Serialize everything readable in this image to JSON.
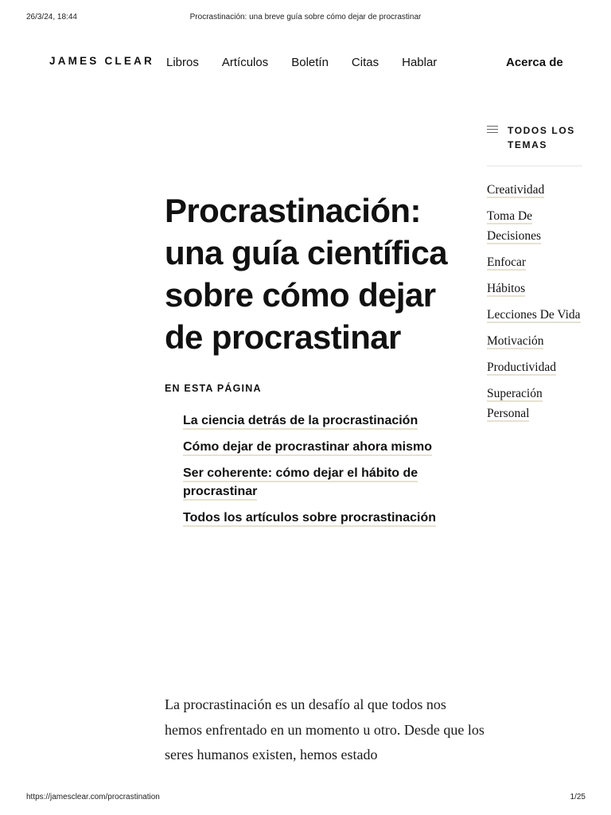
{
  "print_header": {
    "datetime": "26/3/24, 18:44",
    "page_title": "Procrastinación: una breve guía sobre cómo dejar de procrastinar"
  },
  "nav": {
    "logo": "JAMES CLEAR",
    "links": [
      "Libros",
      "Artículos",
      "Boletín",
      "Citas",
      "Hablar"
    ],
    "about": "Acerca de"
  },
  "article": {
    "title": "Procrastinación: una guía científica sobre cómo dejar de procrastinar",
    "toc_heading": "EN ESTA PÁGINA",
    "toc_items": [
      "La ciencia detrás de la procrastinación",
      "Cómo dejar de procrastinar ahora mismo",
      "Ser coherente: cómo dejar el hábito de procrastinar",
      "Todos los artículos sobre procrastinación"
    ],
    "body": "La procrastinación es un desafío al que todos nos hemos enfrentado en un momento u otro. Desde que los seres humanos existen, hemos estado"
  },
  "sidebar": {
    "heading": "TODOS LOS TEMAS",
    "heading_icon": "list-icon",
    "topics": [
      "Creatividad",
      "Toma De Decisiones",
      "Enfocar",
      "Hábitos",
      "Lecciones De Vida",
      "Motivación",
      "Productividad",
      "Superación Personal"
    ]
  },
  "print_footer": {
    "url": "https://jamesclear.com/procrastination",
    "page": "1/25"
  },
  "colors": {
    "link_underline": "#e6e1d0",
    "text": "#111111"
  }
}
